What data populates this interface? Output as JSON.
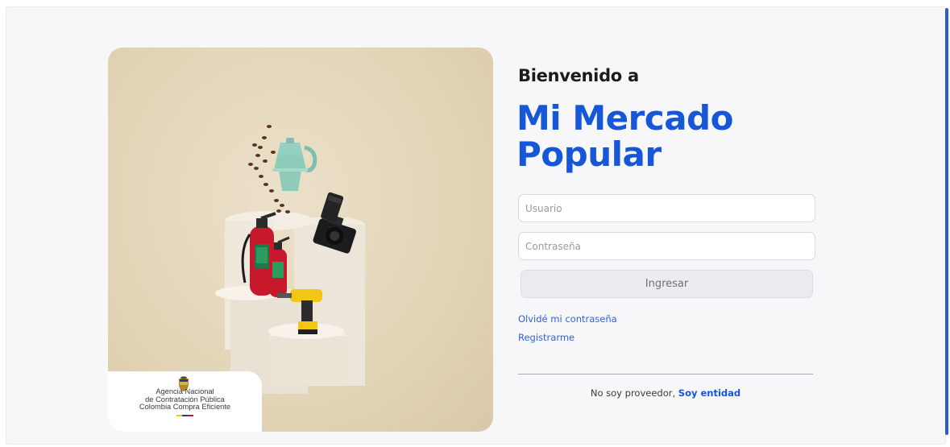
{
  "hero": {
    "logo": {
      "line1": "Agencia Nacional",
      "line2": "de Contratación Pública",
      "line3": "Colombia Compra Eficiente",
      "flag_colors": [
        "#f4c300",
        "#1c3f94",
        "#ce1126"
      ]
    }
  },
  "header": {
    "welcome": "Bienvenido a",
    "brand_line1": "Mi Mercado",
    "brand_line2": "Popular",
    "brand_color": "#1656d8"
  },
  "login": {
    "username_placeholder": "Usuario",
    "password_placeholder": "Contraseña",
    "submit_label": "Ingresar",
    "forgot_password": "Olvidé mi contraseña",
    "register": "Registrarme"
  },
  "footer": {
    "not_provider": "No soy proveedor,",
    "entity_link": "Soy entidad"
  },
  "colors": {
    "accent": "#1656d8",
    "link": "#2f63d8",
    "scrollbar": "#2a5bd7"
  }
}
